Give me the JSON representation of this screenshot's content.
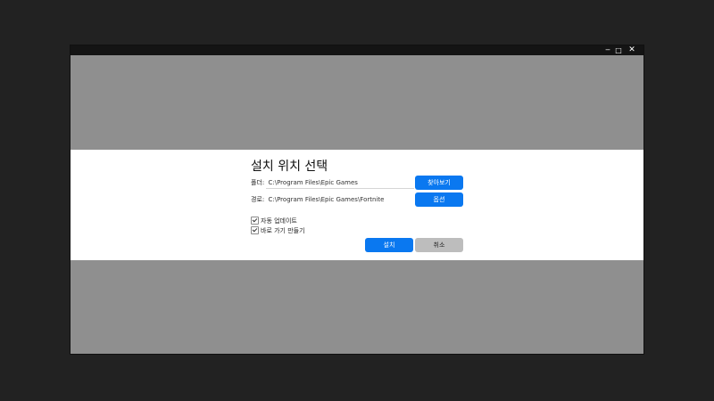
{
  "window": {
    "controls": {
      "minimize": "‒",
      "maximize": "□",
      "close": "✕"
    }
  },
  "dialog": {
    "title": "설치 위치 선택",
    "folder": {
      "label": "폴더:",
      "value": "C:\\Program Files\\Epic Games",
      "button_label": "찾아보기"
    },
    "path": {
      "label": "경로:",
      "value": "C:\\Program Files\\Epic Games\\Fortnite",
      "button_label": "옵션"
    },
    "options": [
      {
        "label": "자동 업데이트",
        "checked": true
      },
      {
        "label": "바로 가기 만들기",
        "checked": true
      }
    ],
    "install_label": "설치",
    "cancel_label": "취소"
  },
  "colors": {
    "desktop": "#222222",
    "window_body": "#8f8f8f",
    "accent_blue": "#0a78f0",
    "cancel_gray": "#bdbdbd"
  }
}
